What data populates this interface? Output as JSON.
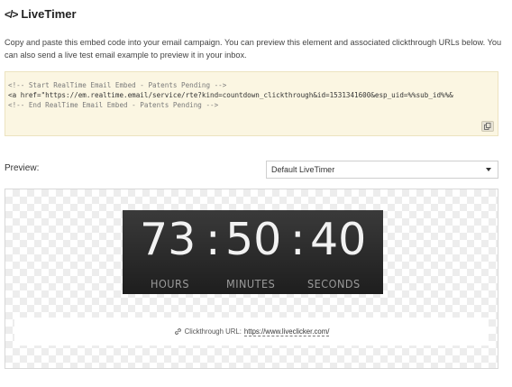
{
  "header": {
    "title": "LiveTimer",
    "icon": "code-icon"
  },
  "intro_text": "Copy and paste this embed code into your email campaign. You can preview this element and associated clickthrough URLs below. You can also send a live test email example to preview it in your inbox.",
  "embed_code": {
    "line1": "<!-- Start RealTime Email Embed - Patents Pending -->",
    "line2": "<a href=\"https://em.realtime.email/service/rte?kind=countdown_clickthrough&id=1531341600&esp_uid=%%sub_id%%&",
    "line3": "<!-- End RealTime Email Embed - Patents Pending -->",
    "copy_icon": "copy-icon"
  },
  "preview": {
    "label": "Preview:",
    "select_value": "Default LiveTimer"
  },
  "timer": {
    "hours": "73",
    "minutes": "50",
    "seconds": "40",
    "sep1": ":",
    "sep2": ":",
    "hours_label": "HOURS",
    "minutes_label": "MINUTES",
    "seconds_label": "SECONDS"
  },
  "clickthrough": {
    "label": "Clickthrough URL:",
    "url": "https://www.liveclicker.com/",
    "icon": "link-icon"
  }
}
